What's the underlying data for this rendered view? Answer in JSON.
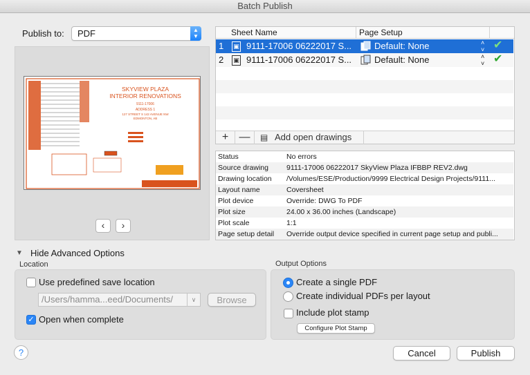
{
  "window": {
    "title": "Batch Publish"
  },
  "publish": {
    "label": "Publish to:",
    "value": "PDF"
  },
  "preview": {
    "sheet_title_1": "SKYVIEW PLAZA",
    "sheet_title_2": "INTERIOR RENOVATIONS",
    "sheet_sub_1": "9111-17006",
    "sheet_sub_2": "ADDRESS 1",
    "sheet_sub_3": "127 STREET S 142 AVENUE NW",
    "sheet_sub_4": "EDMONTON, AB"
  },
  "sheets_table": {
    "col_sheet": "Sheet Name",
    "col_setup": "Page Setup",
    "rows": [
      {
        "num": "1",
        "name": "9111-17006 06222017 S...",
        "setup": "Default: None"
      },
      {
        "num": "2",
        "name": "9111-17006 06222017 S...",
        "setup": "Default: None"
      }
    ]
  },
  "toolbar": {
    "add_label": "+",
    "remove_label": "—",
    "add_open_label": "Add open drawings"
  },
  "details": [
    {
      "key": "Status",
      "value": "No errors"
    },
    {
      "key": "Source drawing",
      "value": "9111-17006 06222017 SkyView Plaza IFBBP REV2.dwg"
    },
    {
      "key": "Drawing location",
      "value": "/Volumes/ESE/Production/9999 Electrical Design Projects/9111..."
    },
    {
      "key": "Layout name",
      "value": "Coversheet"
    },
    {
      "key": "Plot device",
      "value": "Override: DWG To PDF"
    },
    {
      "key": "Plot size",
      "value": "24.00 x 36.00 inches (Landscape)"
    },
    {
      "key": "Plot scale",
      "value": "1:1"
    },
    {
      "key": "Page setup detail",
      "value": "Override output device specified in current page setup and publi..."
    }
  ],
  "advanced": {
    "toggle_label": "Hide Advanced Options"
  },
  "location": {
    "section": "Location",
    "predefined_label": "Use predefined save location",
    "predefined_checked": false,
    "path_value": "/Users/hamma...eed/Documents/",
    "browse_label": "Browse",
    "open_label": "Open when complete",
    "open_checked": true
  },
  "output": {
    "section": "Output Options",
    "single_label": "Create a single PDF",
    "individual_label": "Create individual PDFs per layout",
    "stamp_label": "Include plot stamp",
    "configure_label": "Configure Plot Stamp"
  },
  "buttons": {
    "help": "?",
    "cancel": "Cancel",
    "publish": "Publish"
  },
  "colors": {
    "accent": "#2b86f6",
    "selection": "#1f6fd6",
    "check": "#2fa82f",
    "sheet_red": "#d9531e"
  }
}
